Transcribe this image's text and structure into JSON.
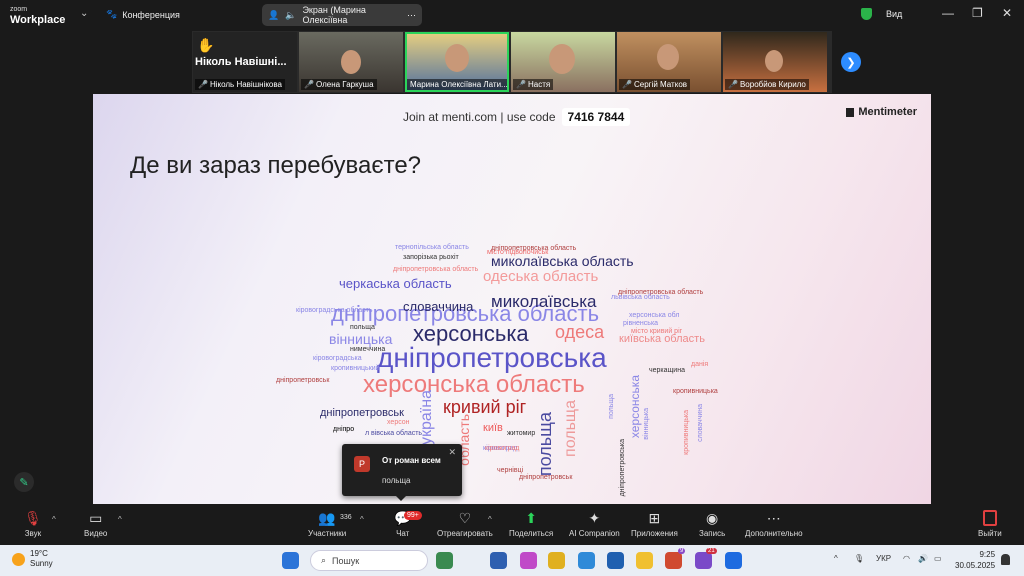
{
  "app": {
    "brand_top": "zoom",
    "brand_bottom": "Workplace",
    "conference_label": "Конференция",
    "share_label": "Экран (Марина Олексіївна",
    "view_label": "Вид"
  },
  "participants": [
    {
      "name": "Ніколь Навішнікова",
      "big_name": "Ніколь Навішні..."
    },
    {
      "name": "Олена Гаркуша"
    },
    {
      "name": "Марина Олексіївна Лати..."
    },
    {
      "name": "Настя"
    },
    {
      "name": "Сергій Матков"
    },
    {
      "name": "Воробйов Кирило"
    }
  ],
  "slide": {
    "join_text": "Join at menti.com | use code",
    "code": "7416 7844",
    "menti_brand": "Mentimeter",
    "question": "Де ви зараз перебуваєте?"
  },
  "wordcloud": [
    "дніпропетровська",
    "херсонська область",
    "дніпропетровська область",
    "херсонська",
    "миколаївська",
    "кривий ріг",
    "одеса",
    "одеська область",
    "миколаївська область",
    "черкаська область",
    "словаччина",
    "вінницька",
    "київська область",
    "дніпропетровськ",
    "київ",
    "україна",
    "польща",
    "польща",
    "область",
    "херсонська",
    "кропивницька",
    "тернопільська область",
    "запорізька рьохіт",
    "дніпропетровська область",
    "місто підволочиськ",
    "дніпропетровська область",
    "кіровоградська область",
    "польща",
    "нимеччина",
    "кіровоградська",
    "кропивницький",
    "дніпропетровськ",
    "кіровоград",
    "дніпро",
    "херсонська обл",
    "рівненська",
    "місто кривий ріг",
    "дніпропетровська область",
    "львівська область",
    "черкащина",
    "данія",
    "кропивницька",
    "вінницька",
    "чернівці",
    "дніпропетровськ",
    "житомир",
    "херсон",
    "кіровоград",
    "л вівська область",
    "дніпро",
    "польща",
    "словаччина",
    "дніпропетровська"
  ],
  "chat_toast": {
    "avatar": "Р",
    "from": "От роман всем",
    "message": "польща"
  },
  "toolbar": {
    "audio": "Звук",
    "video": "Видео",
    "participants": "Участники",
    "participants_count": "336",
    "chat": "Чат",
    "chat_badge": "99+",
    "react": "Отреагировать",
    "share": "Поделиться",
    "ai": "AI Companion",
    "apps": "Приложения",
    "record": "Запись",
    "more": "Дополнительно",
    "leave": "Выйти"
  },
  "taskbar": {
    "temp": "19°C",
    "weather": "Sunny",
    "search": "Пошук",
    "lang": "УКР",
    "time": "9:25",
    "date": "30.05.2025",
    "badge_a": "9",
    "badge_b": "21"
  }
}
